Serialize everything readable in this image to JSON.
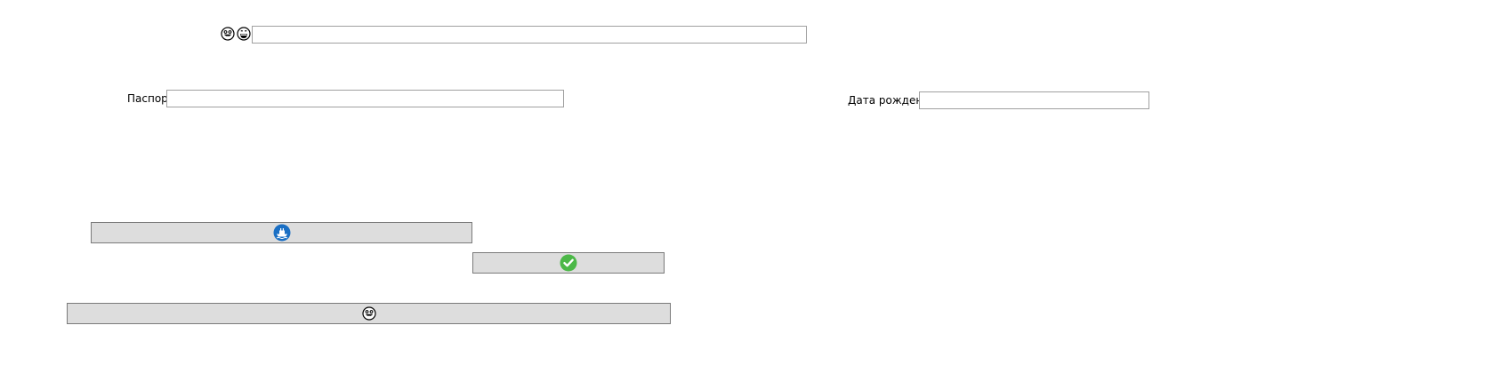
{
  "top_row": {
    "icons": [
      "grinning-tongue-face-icon",
      "grinning-face-icon"
    ],
    "input_value": "",
    "input_placeholder": ""
  },
  "passport": {
    "label": "Паспорт",
    "value": ""
  },
  "birth_date": {
    "label": "Дата рождения",
    "value": ""
  },
  "buttons": {
    "ship_button": {
      "icon": "ship-icon",
      "accent": "#1a6fc4"
    },
    "confirm_button": {
      "icon": "checkmark-icon",
      "accent": "#4cb848"
    },
    "emoji_button": {
      "icon": "grinning-tongue-face-icon"
    }
  }
}
